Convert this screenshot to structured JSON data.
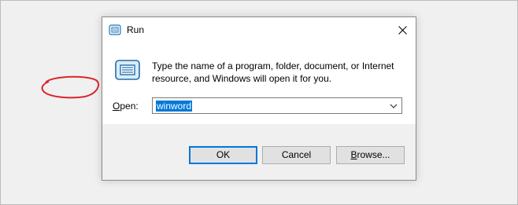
{
  "window": {
    "title": "Run",
    "title_icon": "run-app-icon",
    "close_icon": "close-icon"
  },
  "body": {
    "icon": "run-app-icon",
    "description": "Type the name of a program, folder, document, or Internet resource, and Windows will open it for you.",
    "open_label_prefix": "",
    "open_label_mnemonic": "O",
    "open_label_suffix": "pen:",
    "open_value": "winword",
    "open_value_selected": true,
    "dropdown_icon": "chevron-down-icon"
  },
  "buttons": {
    "ok": "OK",
    "cancel": "Cancel",
    "browse_mnemonic": "B",
    "browse_suffix": "rowse..."
  },
  "colors": {
    "selection": "#0078d7",
    "annotation": "#d9262b",
    "default_button_border": "#0078d7"
  }
}
